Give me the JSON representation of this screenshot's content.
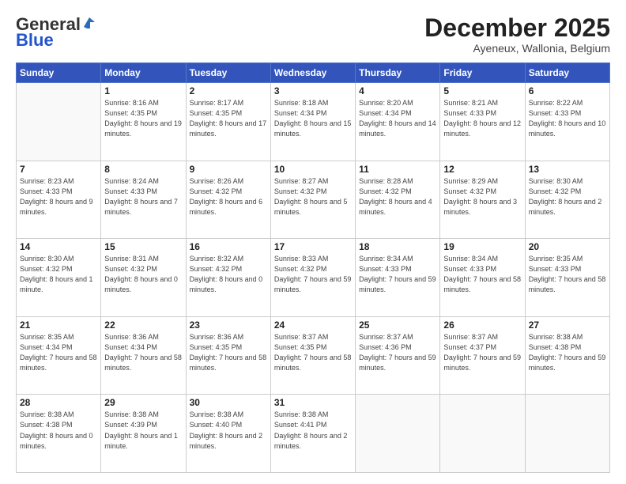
{
  "logo": {
    "line1": "General",
    "line2": "Blue"
  },
  "header": {
    "month": "December 2025",
    "location": "Ayeneux, Wallonia, Belgium"
  },
  "weekdays": [
    "Sunday",
    "Monday",
    "Tuesday",
    "Wednesday",
    "Thursday",
    "Friday",
    "Saturday"
  ],
  "weeks": [
    [
      {
        "day": "",
        "sunrise": "",
        "sunset": "",
        "daylight": ""
      },
      {
        "day": "1",
        "sunrise": "Sunrise: 8:16 AM",
        "sunset": "Sunset: 4:35 PM",
        "daylight": "Daylight: 8 hours and 19 minutes."
      },
      {
        "day": "2",
        "sunrise": "Sunrise: 8:17 AM",
        "sunset": "Sunset: 4:35 PM",
        "daylight": "Daylight: 8 hours and 17 minutes."
      },
      {
        "day": "3",
        "sunrise": "Sunrise: 8:18 AM",
        "sunset": "Sunset: 4:34 PM",
        "daylight": "Daylight: 8 hours and 15 minutes."
      },
      {
        "day": "4",
        "sunrise": "Sunrise: 8:20 AM",
        "sunset": "Sunset: 4:34 PM",
        "daylight": "Daylight: 8 hours and 14 minutes."
      },
      {
        "day": "5",
        "sunrise": "Sunrise: 8:21 AM",
        "sunset": "Sunset: 4:33 PM",
        "daylight": "Daylight: 8 hours and 12 minutes."
      },
      {
        "day": "6",
        "sunrise": "Sunrise: 8:22 AM",
        "sunset": "Sunset: 4:33 PM",
        "daylight": "Daylight: 8 hours and 10 minutes."
      }
    ],
    [
      {
        "day": "7",
        "sunrise": "Sunrise: 8:23 AM",
        "sunset": "Sunset: 4:33 PM",
        "daylight": "Daylight: 8 hours and 9 minutes."
      },
      {
        "day": "8",
        "sunrise": "Sunrise: 8:24 AM",
        "sunset": "Sunset: 4:33 PM",
        "daylight": "Daylight: 8 hours and 7 minutes."
      },
      {
        "day": "9",
        "sunrise": "Sunrise: 8:26 AM",
        "sunset": "Sunset: 4:32 PM",
        "daylight": "Daylight: 8 hours and 6 minutes."
      },
      {
        "day": "10",
        "sunrise": "Sunrise: 8:27 AM",
        "sunset": "Sunset: 4:32 PM",
        "daylight": "Daylight: 8 hours and 5 minutes."
      },
      {
        "day": "11",
        "sunrise": "Sunrise: 8:28 AM",
        "sunset": "Sunset: 4:32 PM",
        "daylight": "Daylight: 8 hours and 4 minutes."
      },
      {
        "day": "12",
        "sunrise": "Sunrise: 8:29 AM",
        "sunset": "Sunset: 4:32 PM",
        "daylight": "Daylight: 8 hours and 3 minutes."
      },
      {
        "day": "13",
        "sunrise": "Sunrise: 8:30 AM",
        "sunset": "Sunset: 4:32 PM",
        "daylight": "Daylight: 8 hours and 2 minutes."
      }
    ],
    [
      {
        "day": "14",
        "sunrise": "Sunrise: 8:30 AM",
        "sunset": "Sunset: 4:32 PM",
        "daylight": "Daylight: 8 hours and 1 minute."
      },
      {
        "day": "15",
        "sunrise": "Sunrise: 8:31 AM",
        "sunset": "Sunset: 4:32 PM",
        "daylight": "Daylight: 8 hours and 0 minutes."
      },
      {
        "day": "16",
        "sunrise": "Sunrise: 8:32 AM",
        "sunset": "Sunset: 4:32 PM",
        "daylight": "Daylight: 8 hours and 0 minutes."
      },
      {
        "day": "17",
        "sunrise": "Sunrise: 8:33 AM",
        "sunset": "Sunset: 4:32 PM",
        "daylight": "Daylight: 7 hours and 59 minutes."
      },
      {
        "day": "18",
        "sunrise": "Sunrise: 8:34 AM",
        "sunset": "Sunset: 4:33 PM",
        "daylight": "Daylight: 7 hours and 59 minutes."
      },
      {
        "day": "19",
        "sunrise": "Sunrise: 8:34 AM",
        "sunset": "Sunset: 4:33 PM",
        "daylight": "Daylight: 7 hours and 58 minutes."
      },
      {
        "day": "20",
        "sunrise": "Sunrise: 8:35 AM",
        "sunset": "Sunset: 4:33 PM",
        "daylight": "Daylight: 7 hours and 58 minutes."
      }
    ],
    [
      {
        "day": "21",
        "sunrise": "Sunrise: 8:35 AM",
        "sunset": "Sunset: 4:34 PM",
        "daylight": "Daylight: 7 hours and 58 minutes."
      },
      {
        "day": "22",
        "sunrise": "Sunrise: 8:36 AM",
        "sunset": "Sunset: 4:34 PM",
        "daylight": "Daylight: 7 hours and 58 minutes."
      },
      {
        "day": "23",
        "sunrise": "Sunrise: 8:36 AM",
        "sunset": "Sunset: 4:35 PM",
        "daylight": "Daylight: 7 hours and 58 minutes."
      },
      {
        "day": "24",
        "sunrise": "Sunrise: 8:37 AM",
        "sunset": "Sunset: 4:35 PM",
        "daylight": "Daylight: 7 hours and 58 minutes."
      },
      {
        "day": "25",
        "sunrise": "Sunrise: 8:37 AM",
        "sunset": "Sunset: 4:36 PM",
        "daylight": "Daylight: 7 hours and 59 minutes."
      },
      {
        "day": "26",
        "sunrise": "Sunrise: 8:37 AM",
        "sunset": "Sunset: 4:37 PM",
        "daylight": "Daylight: 7 hours and 59 minutes."
      },
      {
        "day": "27",
        "sunrise": "Sunrise: 8:38 AM",
        "sunset": "Sunset: 4:38 PM",
        "daylight": "Daylight: 7 hours and 59 minutes."
      }
    ],
    [
      {
        "day": "28",
        "sunrise": "Sunrise: 8:38 AM",
        "sunset": "Sunset: 4:38 PM",
        "daylight": "Daylight: 8 hours and 0 minutes."
      },
      {
        "day": "29",
        "sunrise": "Sunrise: 8:38 AM",
        "sunset": "Sunset: 4:39 PM",
        "daylight": "Daylight: 8 hours and 1 minute."
      },
      {
        "day": "30",
        "sunrise": "Sunrise: 8:38 AM",
        "sunset": "Sunset: 4:40 PM",
        "daylight": "Daylight: 8 hours and 2 minutes."
      },
      {
        "day": "31",
        "sunrise": "Sunrise: 8:38 AM",
        "sunset": "Sunset: 4:41 PM",
        "daylight": "Daylight: 8 hours and 2 minutes."
      },
      {
        "day": "",
        "sunrise": "",
        "sunset": "",
        "daylight": ""
      },
      {
        "day": "",
        "sunrise": "",
        "sunset": "",
        "daylight": ""
      },
      {
        "day": "",
        "sunrise": "",
        "sunset": "",
        "daylight": ""
      }
    ]
  ]
}
